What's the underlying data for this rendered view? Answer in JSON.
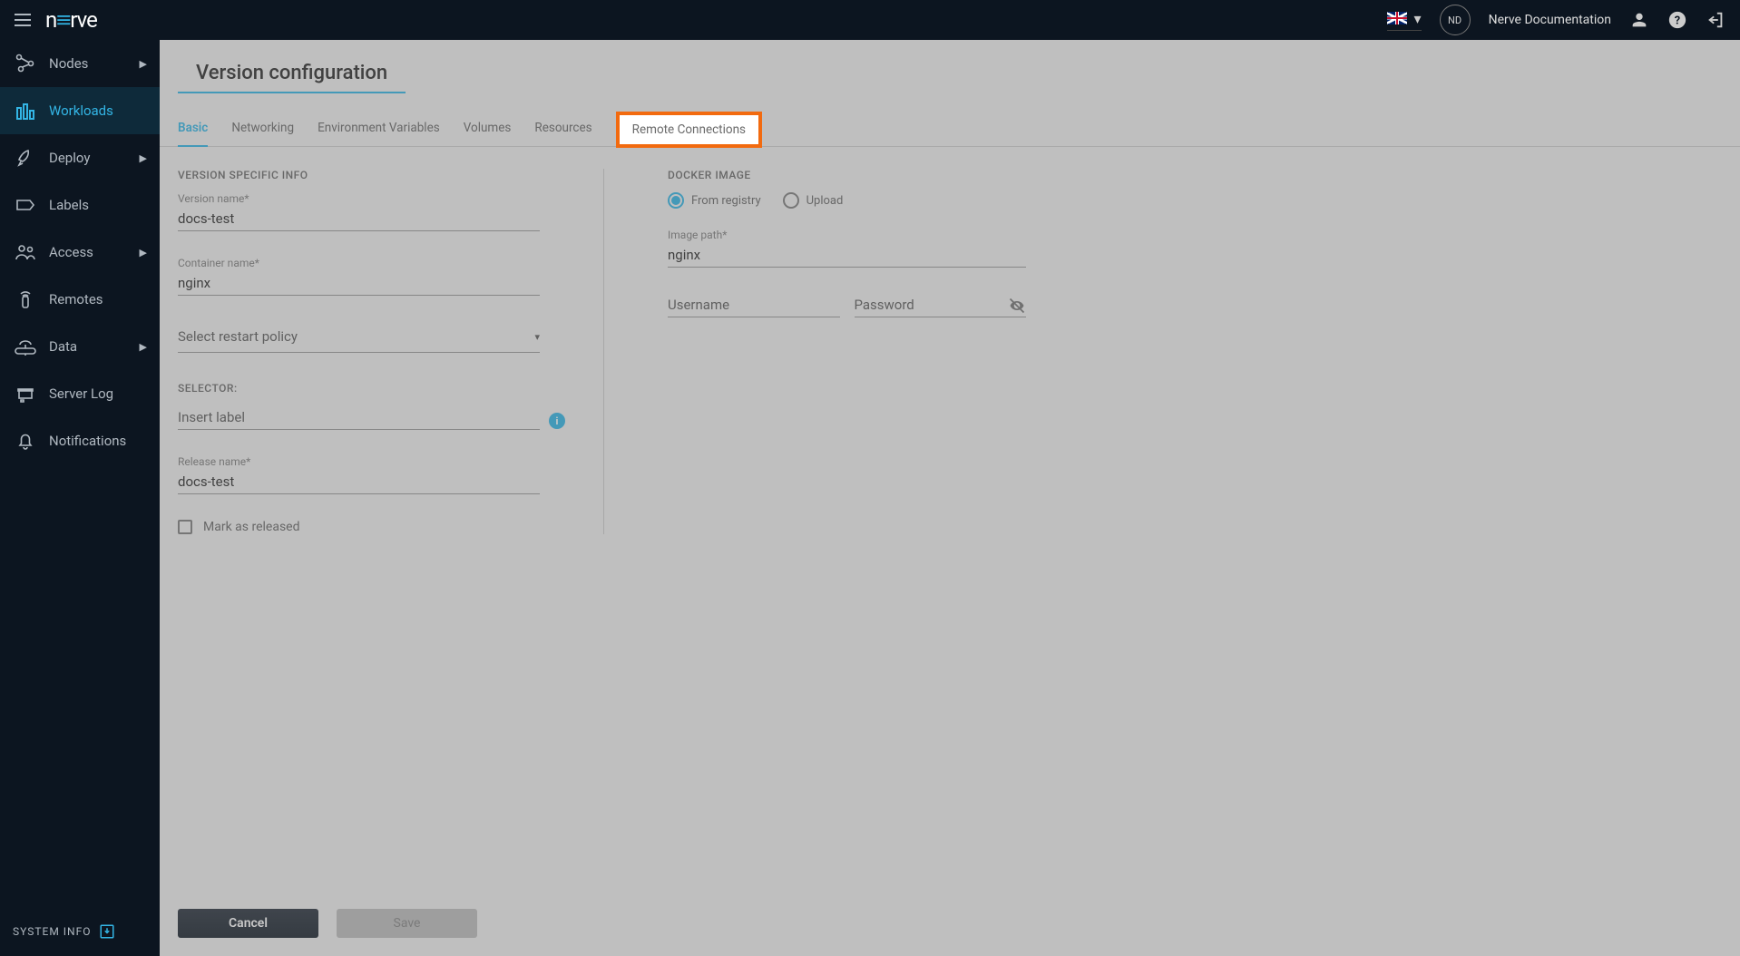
{
  "header": {
    "logo_text": "n≡rve",
    "avatar_initials": "ND",
    "doc_link": "Nerve Documentation"
  },
  "sidebar": {
    "items": [
      {
        "label": "Nodes",
        "has_chevron": true
      },
      {
        "label": "Workloads",
        "has_chevron": false
      },
      {
        "label": "Deploy",
        "has_chevron": true
      },
      {
        "label": "Labels",
        "has_chevron": false
      },
      {
        "label": "Access",
        "has_chevron": true
      },
      {
        "label": "Remotes",
        "has_chevron": false
      },
      {
        "label": "Data",
        "has_chevron": true
      },
      {
        "label": "Server Log",
        "has_chevron": false
      },
      {
        "label": "Notifications",
        "has_chevron": false
      }
    ],
    "footer": "SYSTEM INFO"
  },
  "page": {
    "title": "Version configuration"
  },
  "tabs": [
    {
      "label": "Basic"
    },
    {
      "label": "Networking"
    },
    {
      "label": "Environment Variables"
    },
    {
      "label": "Volumes"
    },
    {
      "label": "Resources"
    },
    {
      "label": "Remote Connections"
    }
  ],
  "form": {
    "section_version": "VERSION SPECIFIC INFO",
    "version_name_label": "Version name*",
    "version_name_value": "docs-test",
    "container_name_label": "Container name*",
    "container_name_value": "nginx",
    "restart_policy_placeholder": "Select restart policy",
    "selector_label": "SELECTOR:",
    "selector_placeholder": "Insert label",
    "release_name_label": "Release name*",
    "release_name_value": "docs-test",
    "mark_released_label": "Mark as released",
    "docker_section": "DOCKER IMAGE",
    "radio_registry": "From registry",
    "radio_upload": "Upload",
    "image_path_label": "Image path*",
    "image_path_value": "nginx",
    "username_placeholder": "Username",
    "password_placeholder": "Password"
  },
  "actions": {
    "cancel": "Cancel",
    "save": "Save"
  }
}
